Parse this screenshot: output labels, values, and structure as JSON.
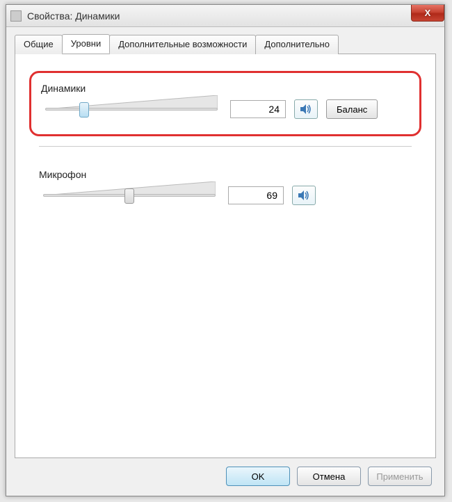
{
  "window": {
    "title": "Свойства: Динамики",
    "close_label": "X"
  },
  "tabs": {
    "general": "Общие",
    "levels": "Уровни",
    "enhancements": "Дополнительные возможности",
    "advanced": "Дополнительно",
    "active": "levels"
  },
  "speakers": {
    "label": "Динамики",
    "value": "24",
    "slider_percent": 24,
    "balance_label": "Баланс",
    "mute_icon": "speaker-icon"
  },
  "microphone": {
    "label": "Микрофон",
    "value": "69",
    "slider_percent": 50,
    "mute_icon": "speaker-icon"
  },
  "footer": {
    "ok": "OK",
    "cancel": "Отмена",
    "apply": "Применить"
  }
}
